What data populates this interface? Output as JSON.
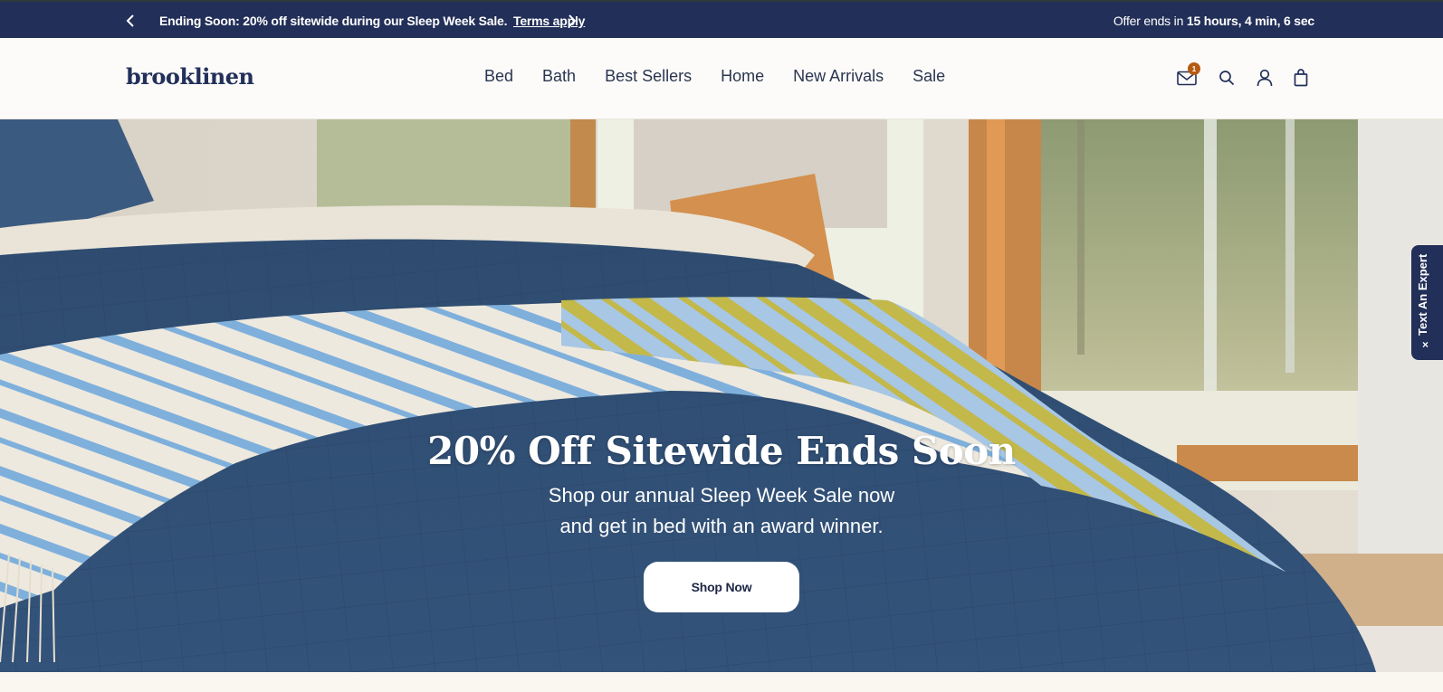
{
  "promo_bar": {
    "message": "Ending Soon: 20% off sitewide during our Sleep Week Sale.",
    "link_text": "Terms apply",
    "timer_prefix": "Offer ends in",
    "timer_value": "15 hours, 4 min, 6 sec",
    "prev_icon": "chevron-left-icon",
    "next_icon": "chevron-right-icon"
  },
  "header": {
    "logo": "brooklinen",
    "nav": [
      "Bed",
      "Bath",
      "Best Sellers",
      "Home",
      "New Arrivals",
      "Sale"
    ],
    "mail_badge": "1",
    "icons": [
      "mail-icon",
      "search-icon",
      "account-icon",
      "bag-icon"
    ]
  },
  "hero": {
    "title": "20% Off Sitewide Ends Soon",
    "subtitle_line1": "Shop our annual Sleep Week Sale now",
    "subtitle_line2": "and get in bed with an award winner.",
    "cta": "Shop Now"
  },
  "expert_tab": {
    "label": "Text An Expert",
    "close": "×"
  },
  "colors": {
    "navy": "#222f58",
    "badge": "#b55a12",
    "background": "#fcfbf9"
  }
}
